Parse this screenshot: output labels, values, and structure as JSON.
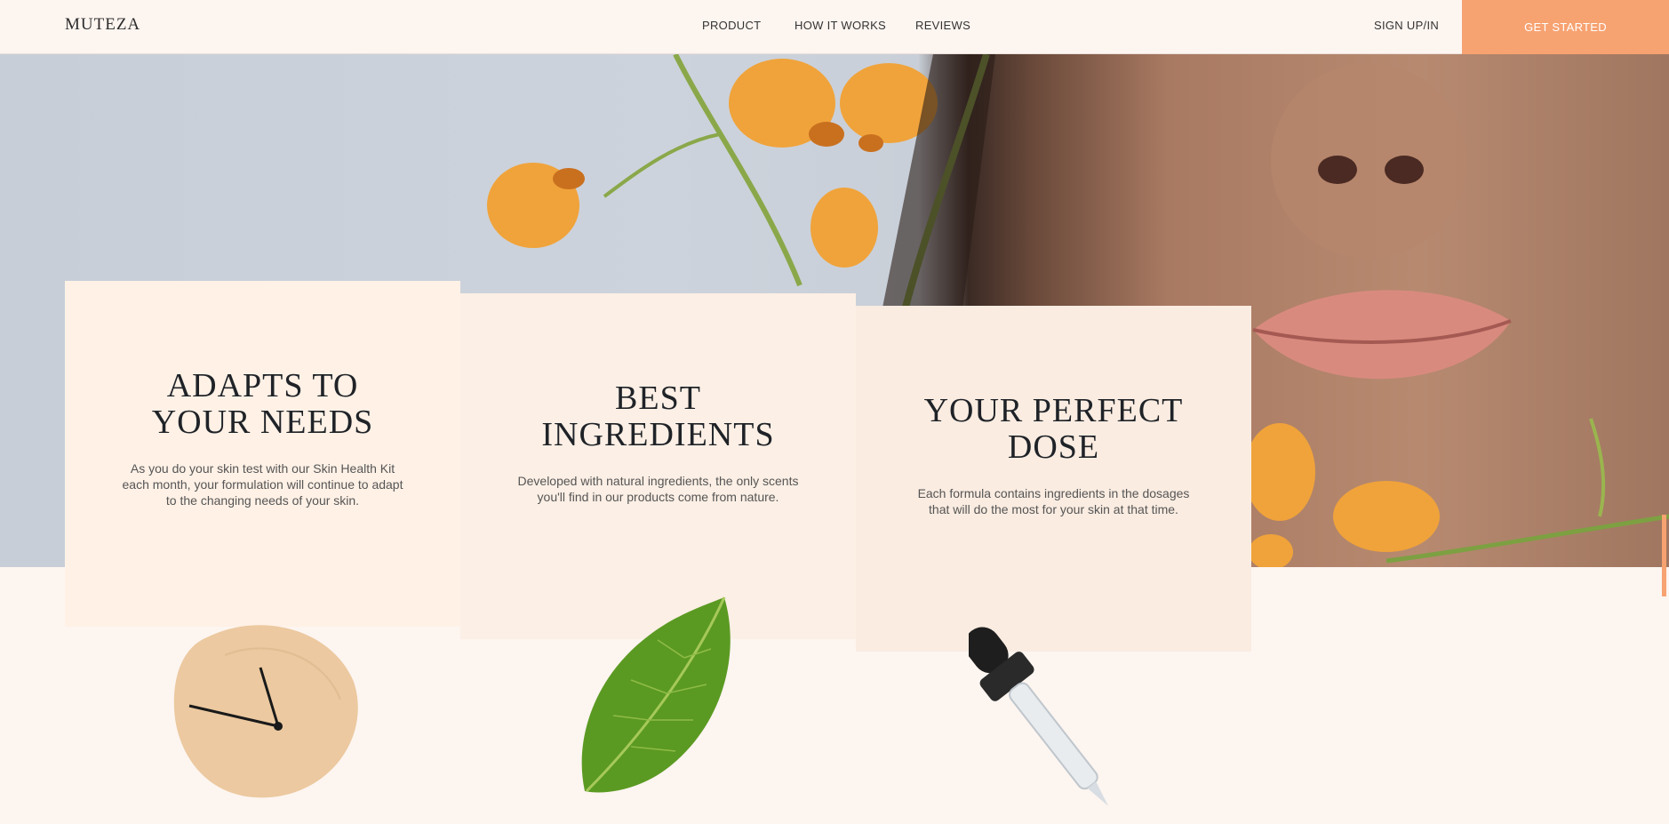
{
  "header": {
    "logo": "MUTEZA",
    "nav": [
      "PRODUCT",
      "HOW IT WORKS",
      "REVIEWS"
    ],
    "sign_in": "SIGN UP/IN",
    "cta": "GET STARTED"
  },
  "features": [
    {
      "title_line1": "ADAPTS TO",
      "title_line2": "YOUR NEEDS",
      "text_line1": "As you do your skin test with our Skin Health Kit",
      "text_line2": "each month, your formulation will continue to adapt",
      "text_line3": "to the changing needs of your skin."
    },
    {
      "title_line1": "BEST",
      "title_line2": "INGREDIENTS",
      "text_line1": "Developed with natural ingredients, the only scents",
      "text_line2": "you'll find in our products come from nature."
    },
    {
      "title_line1": "YOUR PERFECT",
      "title_line2": "DOSE",
      "text_line1": "Each formula contains ingredients in the dosages",
      "text_line2": "that will do the most for your skin at that time."
    }
  ],
  "colors": {
    "accent": "#f7a271",
    "background": "#fdf5f0"
  }
}
